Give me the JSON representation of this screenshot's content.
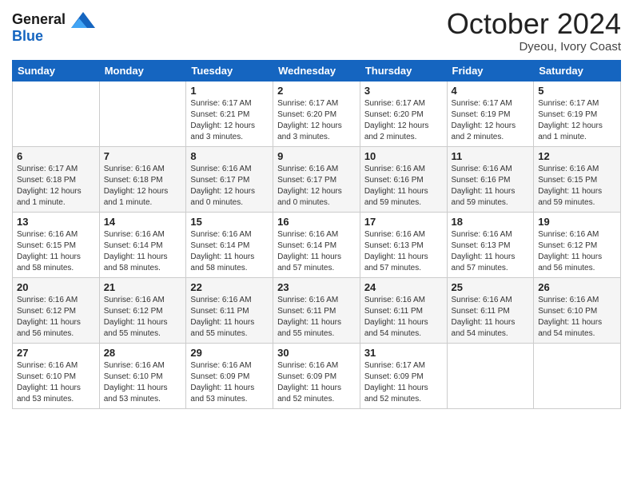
{
  "logo": {
    "line1": "General",
    "line2": "Blue"
  },
  "header": {
    "month": "October 2024",
    "location": "Dyeou, Ivory Coast"
  },
  "weekdays": [
    "Sunday",
    "Monday",
    "Tuesday",
    "Wednesday",
    "Thursday",
    "Friday",
    "Saturday"
  ],
  "weeks": [
    [
      {
        "day": "",
        "sunrise": "",
        "sunset": "",
        "daylight": ""
      },
      {
        "day": "",
        "sunrise": "",
        "sunset": "",
        "daylight": ""
      },
      {
        "day": "1",
        "sunrise": "Sunrise: 6:17 AM",
        "sunset": "Sunset: 6:21 PM",
        "daylight": "Daylight: 12 hours and 3 minutes."
      },
      {
        "day": "2",
        "sunrise": "Sunrise: 6:17 AM",
        "sunset": "Sunset: 6:20 PM",
        "daylight": "Daylight: 12 hours and 3 minutes."
      },
      {
        "day": "3",
        "sunrise": "Sunrise: 6:17 AM",
        "sunset": "Sunset: 6:20 PM",
        "daylight": "Daylight: 12 hours and 2 minutes."
      },
      {
        "day": "4",
        "sunrise": "Sunrise: 6:17 AM",
        "sunset": "Sunset: 6:19 PM",
        "daylight": "Daylight: 12 hours and 2 minutes."
      },
      {
        "day": "5",
        "sunrise": "Sunrise: 6:17 AM",
        "sunset": "Sunset: 6:19 PM",
        "daylight": "Daylight: 12 hours and 1 minute."
      }
    ],
    [
      {
        "day": "6",
        "sunrise": "Sunrise: 6:17 AM",
        "sunset": "Sunset: 6:18 PM",
        "daylight": "Daylight: 12 hours and 1 minute."
      },
      {
        "day": "7",
        "sunrise": "Sunrise: 6:16 AM",
        "sunset": "Sunset: 6:18 PM",
        "daylight": "Daylight: 12 hours and 1 minute."
      },
      {
        "day": "8",
        "sunrise": "Sunrise: 6:16 AM",
        "sunset": "Sunset: 6:17 PM",
        "daylight": "Daylight: 12 hours and 0 minutes."
      },
      {
        "day": "9",
        "sunrise": "Sunrise: 6:16 AM",
        "sunset": "Sunset: 6:17 PM",
        "daylight": "Daylight: 12 hours and 0 minutes."
      },
      {
        "day": "10",
        "sunrise": "Sunrise: 6:16 AM",
        "sunset": "Sunset: 6:16 PM",
        "daylight": "Daylight: 11 hours and 59 minutes."
      },
      {
        "day": "11",
        "sunrise": "Sunrise: 6:16 AM",
        "sunset": "Sunset: 6:16 PM",
        "daylight": "Daylight: 11 hours and 59 minutes."
      },
      {
        "day": "12",
        "sunrise": "Sunrise: 6:16 AM",
        "sunset": "Sunset: 6:15 PM",
        "daylight": "Daylight: 11 hours and 59 minutes."
      }
    ],
    [
      {
        "day": "13",
        "sunrise": "Sunrise: 6:16 AM",
        "sunset": "Sunset: 6:15 PM",
        "daylight": "Daylight: 11 hours and 58 minutes."
      },
      {
        "day": "14",
        "sunrise": "Sunrise: 6:16 AM",
        "sunset": "Sunset: 6:14 PM",
        "daylight": "Daylight: 11 hours and 58 minutes."
      },
      {
        "day": "15",
        "sunrise": "Sunrise: 6:16 AM",
        "sunset": "Sunset: 6:14 PM",
        "daylight": "Daylight: 11 hours and 58 minutes."
      },
      {
        "day": "16",
        "sunrise": "Sunrise: 6:16 AM",
        "sunset": "Sunset: 6:14 PM",
        "daylight": "Daylight: 11 hours and 57 minutes."
      },
      {
        "day": "17",
        "sunrise": "Sunrise: 6:16 AM",
        "sunset": "Sunset: 6:13 PM",
        "daylight": "Daylight: 11 hours and 57 minutes."
      },
      {
        "day": "18",
        "sunrise": "Sunrise: 6:16 AM",
        "sunset": "Sunset: 6:13 PM",
        "daylight": "Daylight: 11 hours and 57 minutes."
      },
      {
        "day": "19",
        "sunrise": "Sunrise: 6:16 AM",
        "sunset": "Sunset: 6:12 PM",
        "daylight": "Daylight: 11 hours and 56 minutes."
      }
    ],
    [
      {
        "day": "20",
        "sunrise": "Sunrise: 6:16 AM",
        "sunset": "Sunset: 6:12 PM",
        "daylight": "Daylight: 11 hours and 56 minutes."
      },
      {
        "day": "21",
        "sunrise": "Sunrise: 6:16 AM",
        "sunset": "Sunset: 6:12 PM",
        "daylight": "Daylight: 11 hours and 55 minutes."
      },
      {
        "day": "22",
        "sunrise": "Sunrise: 6:16 AM",
        "sunset": "Sunset: 6:11 PM",
        "daylight": "Daylight: 11 hours and 55 minutes."
      },
      {
        "day": "23",
        "sunrise": "Sunrise: 6:16 AM",
        "sunset": "Sunset: 6:11 PM",
        "daylight": "Daylight: 11 hours and 55 minutes."
      },
      {
        "day": "24",
        "sunrise": "Sunrise: 6:16 AM",
        "sunset": "Sunset: 6:11 PM",
        "daylight": "Daylight: 11 hours and 54 minutes."
      },
      {
        "day": "25",
        "sunrise": "Sunrise: 6:16 AM",
        "sunset": "Sunset: 6:11 PM",
        "daylight": "Daylight: 11 hours and 54 minutes."
      },
      {
        "day": "26",
        "sunrise": "Sunrise: 6:16 AM",
        "sunset": "Sunset: 6:10 PM",
        "daylight": "Daylight: 11 hours and 54 minutes."
      }
    ],
    [
      {
        "day": "27",
        "sunrise": "Sunrise: 6:16 AM",
        "sunset": "Sunset: 6:10 PM",
        "daylight": "Daylight: 11 hours and 53 minutes."
      },
      {
        "day": "28",
        "sunrise": "Sunrise: 6:16 AM",
        "sunset": "Sunset: 6:10 PM",
        "daylight": "Daylight: 11 hours and 53 minutes."
      },
      {
        "day": "29",
        "sunrise": "Sunrise: 6:16 AM",
        "sunset": "Sunset: 6:09 PM",
        "daylight": "Daylight: 11 hours and 53 minutes."
      },
      {
        "day": "30",
        "sunrise": "Sunrise: 6:16 AM",
        "sunset": "Sunset: 6:09 PM",
        "daylight": "Daylight: 11 hours and 52 minutes."
      },
      {
        "day": "31",
        "sunrise": "Sunrise: 6:17 AM",
        "sunset": "Sunset: 6:09 PM",
        "daylight": "Daylight: 11 hours and 52 minutes."
      },
      {
        "day": "",
        "sunrise": "",
        "sunset": "",
        "daylight": ""
      },
      {
        "day": "",
        "sunrise": "",
        "sunset": "",
        "daylight": ""
      }
    ]
  ]
}
